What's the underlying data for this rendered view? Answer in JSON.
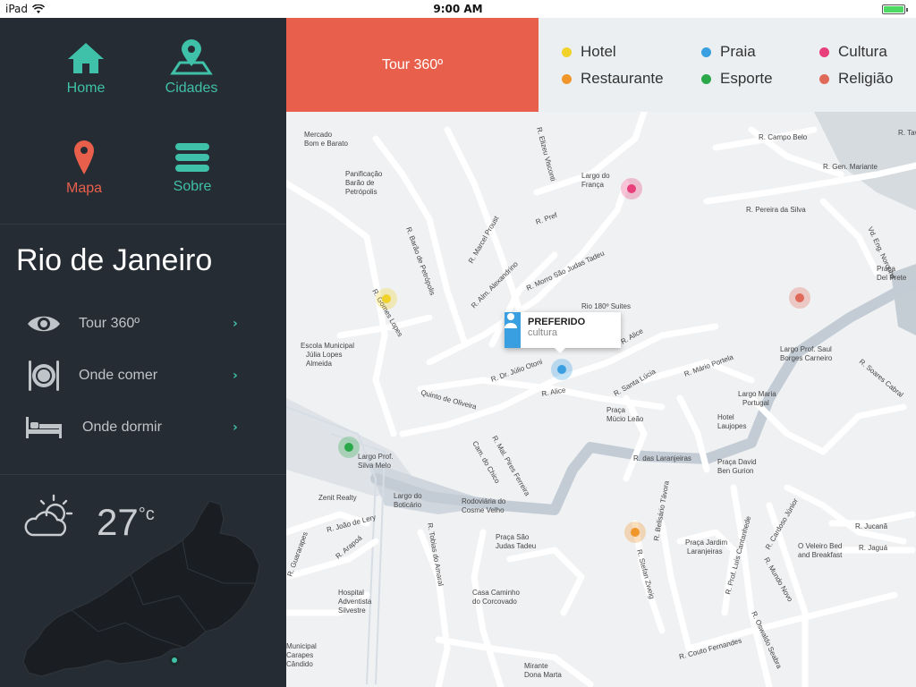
{
  "statusbar": {
    "device": "iPad",
    "time": "9:00 AM",
    "battery_level": 1.0
  },
  "nav": {
    "home": "Home",
    "cidades": "Cidades",
    "mapa": "Mapa",
    "sobre": "Sobre"
  },
  "city": {
    "name": "Rio de Janeiro"
  },
  "menu": [
    {
      "label": "Tour 360º",
      "icon": "eye-icon"
    },
    {
      "label": "Onde comer",
      "icon": "plate-icon"
    },
    {
      "label": "Onde dormir",
      "icon": "bed-icon"
    }
  ],
  "weather": {
    "temperature": "27",
    "unit": "°c",
    "icon": "partly-cloudy-icon"
  },
  "header": {
    "tour": "Tour 360º"
  },
  "legend": [
    {
      "label": "Hotel",
      "color": "#f0d22b"
    },
    {
      "label": "Restaurante",
      "color": "#f0962b"
    },
    {
      "label": "Praia",
      "color": "#3a9fe0"
    },
    {
      "label": "Esporte",
      "color": "#2aa84a"
    },
    {
      "label": "Cultura",
      "color": "#e83e7a"
    },
    {
      "label": "Religião",
      "color": "#e06a5a"
    }
  ],
  "popup": {
    "title": "PREFERIDO",
    "subtitle": "cultura"
  },
  "map_labels": {
    "streets": [
      "R. Campo Belo",
      "R. Gen. Mariante",
      "R. Pereira da Silva",
      "Vd. Eng. Noronha",
      "R. Elizeu Visconti",
      "R. Gomes Lopes",
      "R. Barão de Petrópolis",
      "R. Marcel Proust",
      "R. Alm. Alexandrino",
      "R. Morro São Judas Tadeu",
      "R. Alice",
      "R. Dr. Júlio Otoni",
      "R. Santa Lúcia",
      "R. Mário Portela",
      "R. das Laranjeiras",
      "R. Mal. Pires Ferreira",
      "Cam. do Chico",
      "R. Soares Cabral",
      "R. Cardoso Júnior",
      "R. Jucanã",
      "R. Jaguá",
      "R. Stefan Zweig",
      "R. Belisário Távora",
      "R. Prof. Luís Cantanhede",
      "R. Mundo Novo",
      "R. Oswaldo Seabra",
      "R. Couto Fernandes",
      "R. João de Lery",
      "R. Arapoá",
      "R. Tobias do Amaral",
      "R. Guararapes",
      "Quinto de Oliveira",
      "R. Pref",
      "R. Tavares"
    ],
    "places": [
      "Mercado Bom e Barato",
      "Panificação Barão de Petrópolis",
      "Largo do França",
      "Rio 180º Suites",
      "Escola Municipal Júlia Lopes Almeida",
      "Praça Del Prete",
      "Largo Prof. Saul Borges Carneiro",
      "Largo Maria Portugal",
      "Praça Múcio Leão",
      "Hotel Laujopes",
      "Praça David Ben Gurion",
      "Largo Prof. Silva Melo",
      "Zenit Realty",
      "Largo do Boticário",
      "Rodoviária do Cosme Velho",
      "Praça São Judas Tadeu",
      "Praça Jardim Laranjeiras",
      "O Veleiro Bed and Breakfast",
      "Hospital Adventista Silvestre",
      "Casa Caminho do Corcovado",
      "Mirante Dona Marta",
      "Municipal Carapes Cândido"
    ]
  }
}
